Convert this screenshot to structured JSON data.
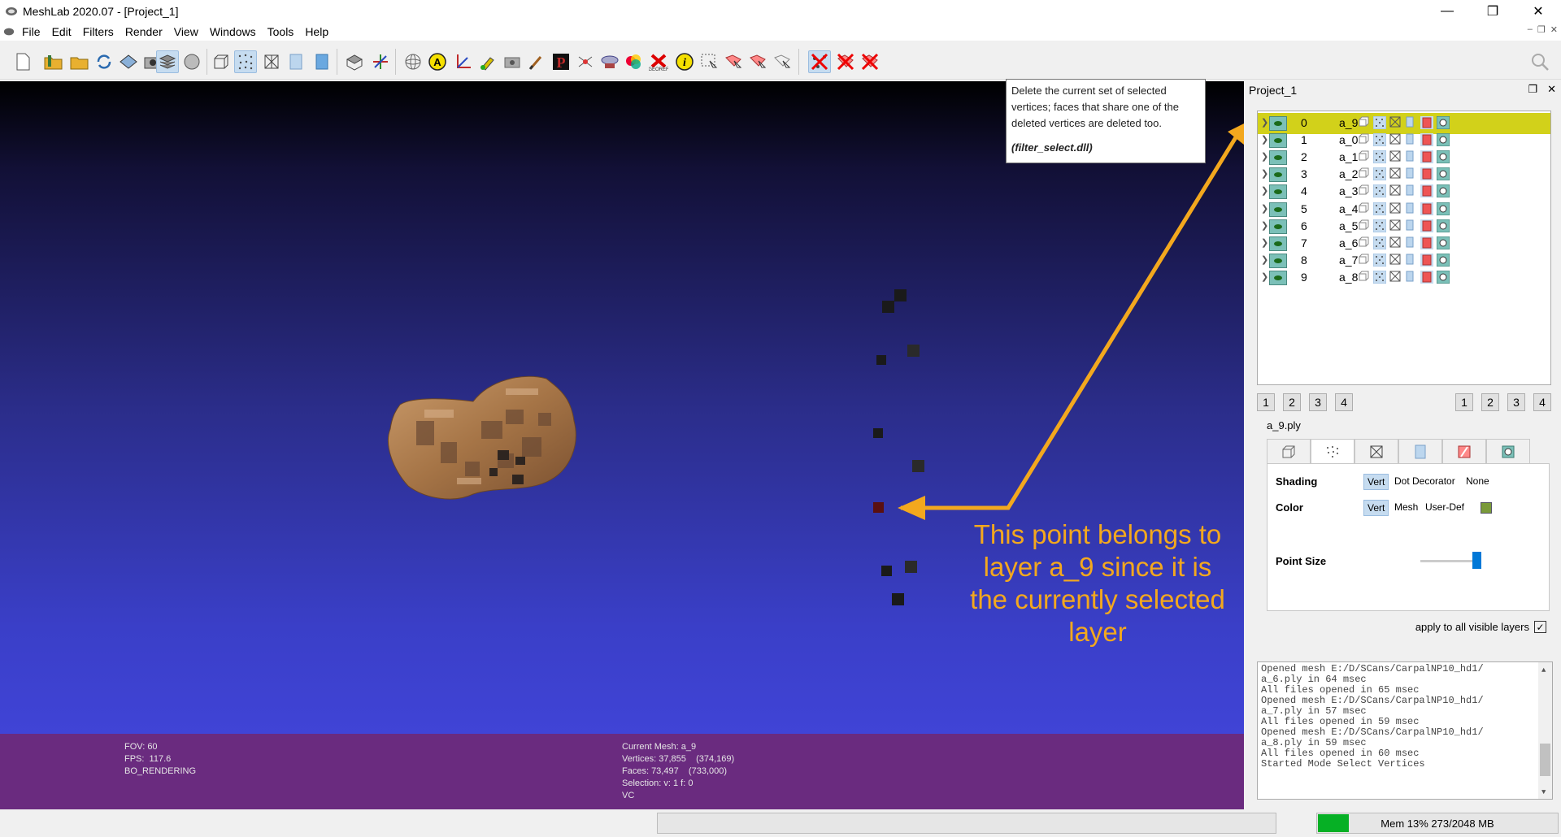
{
  "window": {
    "title": "MeshLab 2020.07 - [Project_1]"
  },
  "menu": [
    "File",
    "Edit",
    "Filters",
    "Render",
    "View",
    "Windows",
    "Tools",
    "Help"
  ],
  "tooltip": {
    "text": "Delete the current set of selected vertices; faces that share one of the deleted vertices are deleted too.",
    "dll": "(filter_select.dll)"
  },
  "annotation": {
    "text": "This point belongs to layer a_9 since it is the currently selected layer",
    "color": "#f3a81e"
  },
  "info": {
    "left": [
      "FOV: 60",
      "FPS:  117.6",
      "BO_RENDERING"
    ],
    "right": [
      "Current Mesh: a_9",
      "Vertices: 37,855    (374,169)",
      "Faces: 73,497    (733,000)",
      "Selection: v: 1 f: 0",
      "VC"
    ]
  },
  "dock": {
    "title": "Project_1",
    "layers": [
      {
        "idx": "0",
        "name": "a_9 *",
        "selected": true
      },
      {
        "idx": "1",
        "name": "a_0"
      },
      {
        "idx": "2",
        "name": "a_1"
      },
      {
        "idx": "3",
        "name": "a_2"
      },
      {
        "idx": "4",
        "name": "a_3"
      },
      {
        "idx": "5",
        "name": "a_4"
      },
      {
        "idx": "6",
        "name": "a_5"
      },
      {
        "idx": "7",
        "name": "a_6"
      },
      {
        "idx": "8",
        "name": "a_7"
      },
      {
        "idx": "9",
        "name": "a_8"
      }
    ],
    "left_buttons": [
      "1",
      "2",
      "3",
      "4"
    ],
    "right_buttons": [
      "1",
      "2",
      "3",
      "4"
    ],
    "filename": "a_9.ply",
    "shading": {
      "label": "Shading",
      "options": [
        "Vert",
        "Dot Decorator",
        "None"
      ],
      "selected": "Vert"
    },
    "color": {
      "label": "Color",
      "options": [
        "Vert",
        "Mesh",
        "User-Def"
      ],
      "selected": "Vert",
      "swatch": "#7a9a3a"
    },
    "point_size": {
      "label": "Point Size"
    },
    "apply_all": {
      "label": "apply to all visible layers",
      "checked": true
    },
    "log": [
      "Opened mesh E:/D/SCans/CarpalNP10_hd1/",
      "a_6.ply in 64 msec",
      "All files opened in 65 msec",
      "Opened mesh E:/D/SCans/CarpalNP10_hd1/",
      "a_7.ply in 57 msec",
      "All files opened in 59 msec",
      "Opened mesh E:/D/SCans/CarpalNP10_hd1/",
      "a_8.ply in 59 msec",
      "All files opened in 60 msec",
      "Started Mode Select Vertices"
    ]
  },
  "status": {
    "mem": "Mem 13% 273/2048 MB",
    "mem_fraction": 0.13
  },
  "icons": {
    "toolbar": [
      "new-file-icon",
      "open-project-icon",
      "open-mesh-icon",
      "reload-icon",
      "save-icon",
      "snapshot-icon",
      "layers-icon",
      "render-mode-icon",
      "bbox-icon",
      "points-icon",
      "wireframe-icon",
      "flat-icon",
      "smooth-icon",
      "grid-icon",
      "axis-icon",
      "trackball-icon",
      "annotation-icon",
      "measure-icon",
      "paint-icon",
      "camera-icon",
      "brush-icon",
      "pick-points-icon",
      "align-icon",
      "georef-icon",
      "color-icon",
      "x-icon",
      "info-icon",
      "select-faces-icon",
      "select-vertices-icon",
      "select-connected-icon",
      "select-mesh-icon",
      "delete-selected-faces-icon",
      "delete-selected-vertices-icon",
      "delete-selected-faces-vertices-icon"
    ]
  }
}
